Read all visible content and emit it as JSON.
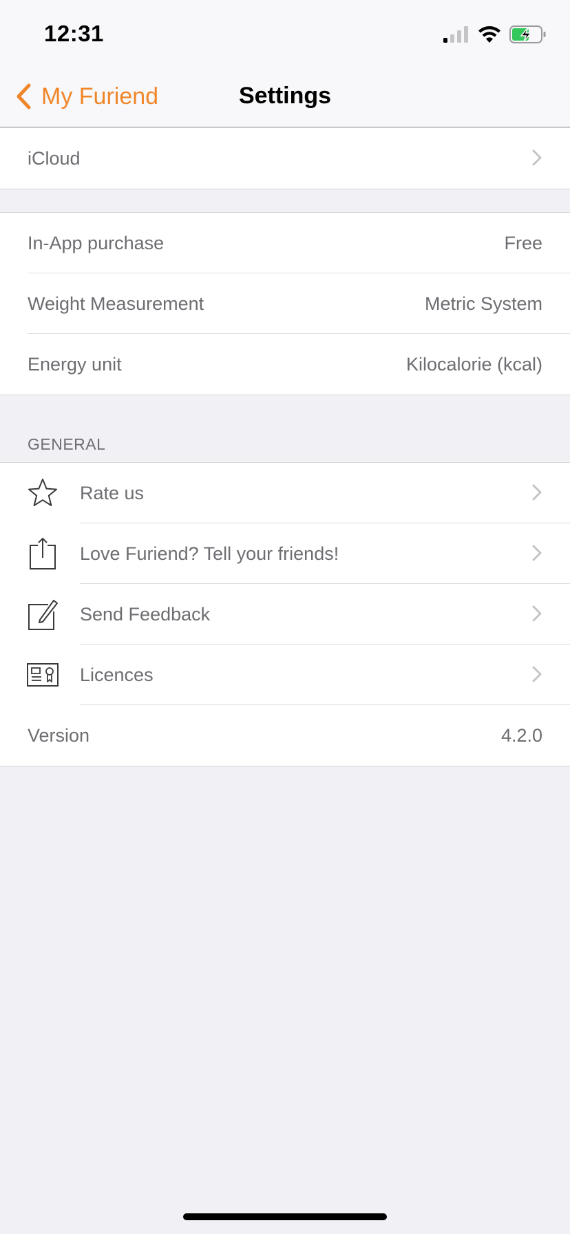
{
  "status_bar": {
    "time": "12:31"
  },
  "nav": {
    "back_label": "My Furiend",
    "title": "Settings"
  },
  "groups": {
    "icloud": {
      "label": "iCloud"
    },
    "prefs": {
      "in_app_label": "In-App purchase",
      "in_app_value": "Free",
      "weight_label": "Weight Measurement",
      "weight_value": "Metric System",
      "energy_label": "Energy unit",
      "energy_value": "Kilocalorie (kcal)"
    },
    "general": {
      "header": "GENERAL",
      "rate_label": "Rate us",
      "share_label": "Love Furiend? Tell your friends!",
      "feedback_label": "Send Feedback",
      "licences_label": "Licences",
      "version_label": "Version",
      "version_value": "4.2.0"
    }
  },
  "colors": {
    "accent": "#f0862a",
    "background": "#f0f0f5",
    "text_secondary": "#6d6d72",
    "battery_green": "#34c759"
  },
  "icons": [
    "signal-icon",
    "wifi-icon",
    "battery-charging-icon",
    "chevron-left-icon",
    "chevron-right-icon",
    "star-icon",
    "share-icon",
    "compose-icon",
    "certificate-icon"
  ]
}
